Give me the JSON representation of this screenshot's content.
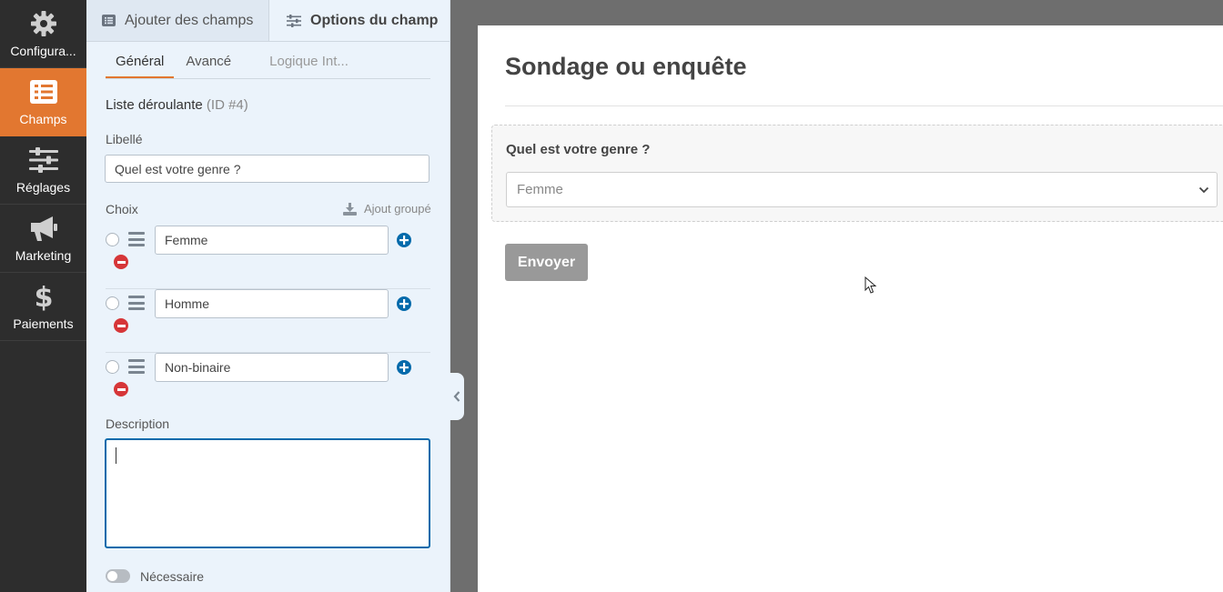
{
  "leftnav": {
    "items": [
      {
        "label": "Configura...",
        "icon": "gear-icon",
        "active": false
      },
      {
        "label": "Champs",
        "icon": "list-icon",
        "active": true
      },
      {
        "label": "Réglages",
        "icon": "sliders-icon",
        "active": false
      },
      {
        "label": "Marketing",
        "icon": "megaphone-icon",
        "active": false
      },
      {
        "label": "Paiements",
        "icon": "dollar-icon",
        "active": false
      }
    ],
    "accent": "#e27730"
  },
  "panel": {
    "tabs": {
      "add_fields": "Ajouter des champs",
      "field_options": "Options du champ"
    },
    "subtabs": {
      "general": "Général",
      "advanced": "Avancé",
      "logic": "Logique Int..."
    },
    "field_type": "Liste déroulante",
    "field_id": "(ID #4)",
    "label_heading": "Libellé",
    "label_value": "Quel est votre genre ?",
    "choices_heading": "Choix",
    "bulk_add": "Ajout groupé",
    "choices": [
      "Femme",
      "Homme",
      "Non-binaire"
    ],
    "description_heading": "Description",
    "description_value": "",
    "required_label": "Nécessaire",
    "required": false
  },
  "preview": {
    "form_title": "Sondage ou enquête",
    "question": "Quel est votre genre ?",
    "select_value": "Femme",
    "submit_label": "Envoyer"
  },
  "colors": {
    "primary_blue": "#036aab",
    "remove_red": "#d63638",
    "nav_bg": "#2d2d2d",
    "panel_bg": "#ebf3fb"
  }
}
